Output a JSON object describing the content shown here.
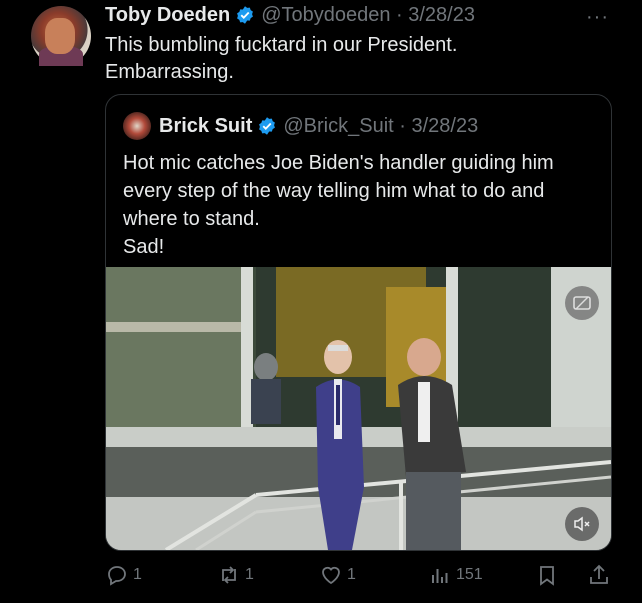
{
  "tweet": {
    "author_name": "Toby Doeden",
    "handle_date": "@Tobydoeden · 3/28/23",
    "more": "···",
    "text_line1": "This bumbling fucktard in our President.",
    "text_line2": "Embarrassing."
  },
  "quote": {
    "author_name": "Brick Suit",
    "handle_date": "@Brick_Suit · 3/28/23",
    "text_line1": "Hot mic catches Joe Biden's handler guiding him",
    "text_line2": "every step of the way telling him what to do and",
    "text_line3": "where to stand.",
    "text_line4": "Sad!"
  },
  "actions": {
    "replies": "1",
    "retweets": "1",
    "likes": "1",
    "views": "151"
  },
  "colors": {
    "background": "#000000",
    "text": "#e7e9ea",
    "muted": "#71767b",
    "verified": "#1d9bf0",
    "border": "#2f3336"
  },
  "icons": [
    "verified-badge-icon",
    "more-icon",
    "reply-icon",
    "retweet-icon",
    "like-icon",
    "views-icon",
    "bookmark-icon",
    "share-icon",
    "gif-control-icon",
    "mute-icon"
  ]
}
